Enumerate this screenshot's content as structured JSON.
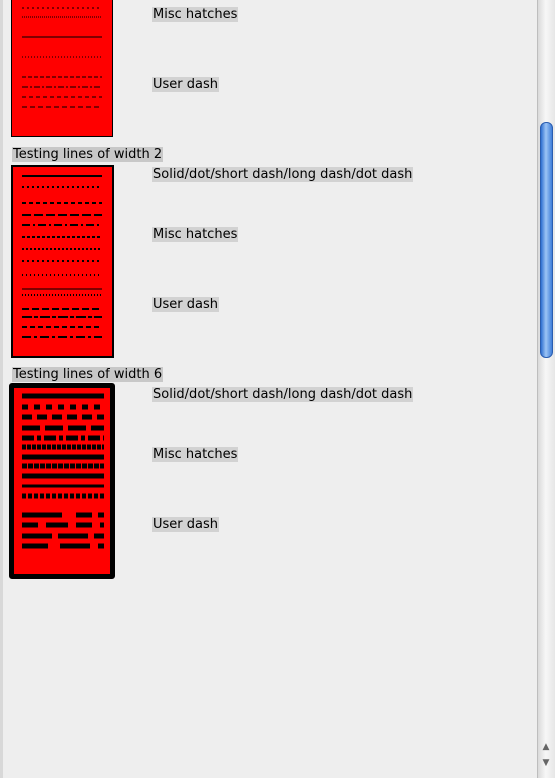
{
  "samples": [
    {
      "title": null,
      "labels": [
        "Misc hatches",
        "User dash"
      ]
    },
    {
      "title": "Testing lines of width 2",
      "labels": [
        "Solid/dot/short dash/long dash/dot dash",
        "Misc hatches",
        "User dash"
      ]
    },
    {
      "title": "Testing lines of width 6",
      "labels": [
        "Solid/dot/short dash/long dash/dot dash",
        "Misc hatches",
        "User dash"
      ]
    }
  ],
  "colors": {
    "fill": "#ff0000",
    "line": "#000000",
    "background": "#eeeeee",
    "scroll_thumb": "#3f7ed9"
  }
}
